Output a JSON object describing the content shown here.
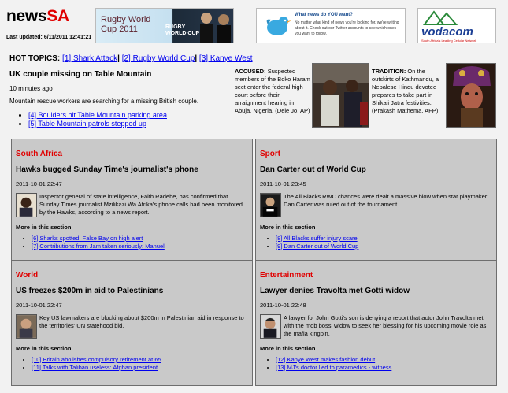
{
  "site": {
    "name_part1": "news",
    "name_part2": "SA",
    "last_updated": "Last updated: 6/11/2011 12:41:21"
  },
  "ads": {
    "rugby": {
      "text_line1": "Rugby World",
      "text_line2": "Cup 2011",
      "brand_line1": "RUGBY",
      "brand_line2": "WORLD CUP 2011"
    },
    "twitter": {
      "heading": "What news do YOU want?",
      "body": "No matter what kind of news you're looking for, we're writing about it. Check out our Twitter accounts to see which ones you want to follow."
    },
    "vodacom": {
      "wordmark": "vodacom",
      "slogan": "South Africa's Leading Cellular Network"
    }
  },
  "hot_topics": {
    "label": "HOT TOPICS:",
    "items": [
      "[1] Shark Attack",
      "[2] Rugby World Cup",
      "[3] Kanye West"
    ],
    "sep": "|"
  },
  "lead": {
    "title": "UK couple missing on Table Mountain",
    "time": "10 minutes ago",
    "summary": "Mountain rescue workers are searching for a missing British couple.",
    "links": [
      "[4] Boulders hit Table Mountain parking area",
      "[5] Table Mountain patrols stepped up"
    ]
  },
  "captions": {
    "accused": {
      "label": "ACCUSED:",
      "text": "Suspected members of the Boko Haram sect enter the federal high court before their arraignment hearing in Abuja, Nigeria. (Dele Jo, AP)"
    },
    "tradition": {
      "label": "TRADITION:",
      "text": "On the outskirts of Kathmandu, a Nepalese Hindu devotee prepares to take part in Shikali Jatra festivities. (Prakash Mathema, AFP)"
    }
  },
  "panels": [
    {
      "section": "South Africa",
      "title": "Hawks bugged Sunday Time's journalist's phone",
      "date": "2011-10-01 22:47",
      "summary": "Inspector general of state intelligence, Faith Radebe, has confirmed that Sunday Times journalist Mzilikazi Wa Afrika's phone calls had been monitored by the Hawks, according to a news report.",
      "more": "More in this section",
      "links": [
        "[6] Sharks spotted: False Bay on high alert",
        "[7] Contributions from Jam taken seriously: Manuel"
      ]
    },
    {
      "section": "Sport",
      "title": "Dan Carter out of World Cup",
      "date": "2011-10-01 23:45",
      "summary": "The All Blacks RWC chances were dealt a massive blow when star playmaker Dan Carter was ruled out of the tournament.",
      "more": "More in this section",
      "links": [
        "[8] All Blacks suffer injury scare",
        "[9] Dan Carter out of World Cup"
      ]
    },
    {
      "section": "World",
      "title": "US freezes $200m in aid to Palestinians",
      "date": "2011-10-01 22:47",
      "summary": "Key US lawmakers are blocking about $200m in Palestinian aid in response to the territories' UN statehood bid.",
      "more": "More in this section",
      "links": [
        "[10] Britain abolishes compulsory retirement at 65",
        "[11] Talks with Taliban useless: Afghan president"
      ]
    },
    {
      "section": "Entertainment",
      "title": "Lawyer denies Travolta met Gotti widow",
      "date": "2011-10-01 22:48",
      "summary": "A lawyer for John Gotti's son is denying a report that actor John Travolta met with the mob boss' widow to seek her blessing for his upcoming movie role as the mafia kingpin.",
      "more": "More in this section",
      "links": [
        "[12] Kanye West makes fashion debut",
        "[13] MJ's doctor lied to paramedics - witness"
      ]
    }
  ]
}
